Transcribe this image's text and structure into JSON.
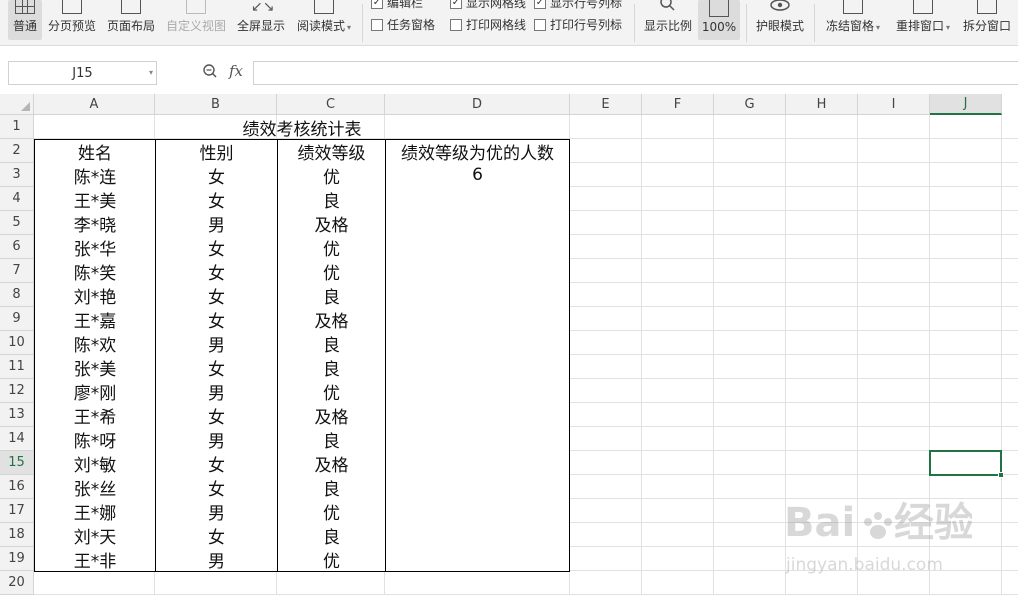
{
  "ribbon": {
    "normal": "普通",
    "page_break_preview": "分页预览",
    "page_layout": "页面布局",
    "custom_view": "自定义视图",
    "full_screen": "全屏显示",
    "reading_mode": "阅读模式",
    "edit_bar": "编辑栏",
    "show_gridlines": "显示网格线",
    "show_headers": "显示行号列标",
    "task_pane": "任务窗格",
    "print_gridlines": "打印网格线",
    "print_headers": "打印行号列标",
    "zoom_ratio": "显示比例",
    "zoom_100": "100%",
    "eye_protection": "护眼模式",
    "freeze_panes": "冻结窗格",
    "arrange_windows": "重排窗口",
    "split_window": "拆分窗口"
  },
  "formula_bar": {
    "name_box": "J15",
    "fx": "fx",
    "content": ""
  },
  "columns": [
    "A",
    "B",
    "C",
    "D",
    "E",
    "F",
    "G",
    "H",
    "I",
    "J"
  ],
  "rows": [
    "1",
    "2",
    "3",
    "4",
    "5",
    "6",
    "7",
    "8",
    "9",
    "10",
    "11",
    "12",
    "13",
    "14",
    "15",
    "16",
    "17",
    "18",
    "19",
    "20"
  ],
  "selected_cell": {
    "column": "J",
    "row": "15"
  },
  "table": {
    "title": "绩效考核统计表",
    "headers": [
      "姓名",
      "性别",
      "绩效等级",
      "绩效等级为优的人数"
    ],
    "excellent_count": "6",
    "records": [
      [
        "陈*连",
        "女",
        "优"
      ],
      [
        "王*美",
        "女",
        "良"
      ],
      [
        "李*晓",
        "男",
        "及格"
      ],
      [
        "张*华",
        "女",
        "优"
      ],
      [
        "陈*笑",
        "女",
        "优"
      ],
      [
        "刘*艳",
        "女",
        "良"
      ],
      [
        "王*嘉",
        "女",
        "及格"
      ],
      [
        "陈*欢",
        "男",
        "良"
      ],
      [
        "张*美",
        "女",
        "良"
      ],
      [
        "廖*刚",
        "男",
        "优"
      ],
      [
        "王*希",
        "女",
        "及格"
      ],
      [
        "陈*呀",
        "男",
        "良"
      ],
      [
        "刘*敏",
        "女",
        "及格"
      ],
      [
        "张*丝",
        "女",
        "良"
      ],
      [
        "王*娜",
        "男",
        "优"
      ],
      [
        "刘*天",
        "女",
        "良"
      ],
      [
        "王*非",
        "男",
        "优"
      ]
    ]
  },
  "colors": {
    "selection": "#217346",
    "table_border": "#000000",
    "grid": "#e1e1e1",
    "header_bg": "#f2f2f2"
  }
}
